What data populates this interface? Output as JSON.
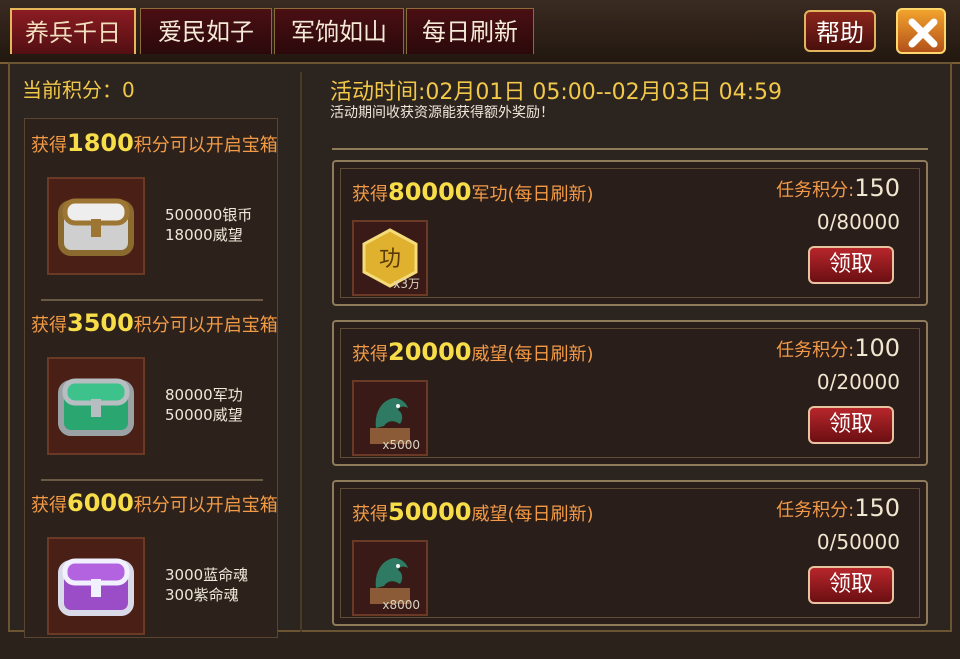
{
  "tabs": [
    {
      "label": "养兵千日"
    },
    {
      "label": "爱民如子"
    },
    {
      "label": "军饷如山"
    },
    {
      "label": "每日刷新"
    }
  ],
  "help_label": "帮助",
  "left": {
    "score_label": "当前积分：0",
    "chests": [
      {
        "title_prefix": "获得",
        "points": "1800",
        "title_suffix": "积分可以开启宝箱",
        "rewards": [
          "500000银币",
          "18000威望"
        ],
        "icon": "silver-chest-icon"
      },
      {
        "title_prefix": "获得",
        "points": "3500",
        "title_suffix": "积分可以开启宝箱",
        "rewards": [
          "80000军功",
          "50000威望"
        ],
        "icon": "green-chest-icon"
      },
      {
        "title_prefix": "获得",
        "points": "6000",
        "title_suffix": "积分可以开启宝箱",
        "rewards": [
          "3000蓝命魂",
          "300紫命魂"
        ],
        "icon": "purple-chest-icon"
      }
    ]
  },
  "event": {
    "time": "活动时间:02月01日 05:00--02月03日 04:59",
    "note": "活动期间收获资源能获得额外奖励！"
  },
  "tasks": [
    {
      "title_prefix": "获得",
      "amount": "80000",
      "title_suffix": "军功(每日刷新)",
      "points_label": "任务积分:",
      "points_value": "150",
      "progress": "0/80000",
      "claim_label": "领取",
      "icon": "merit-icon",
      "icon_text": "功",
      "qty": "x3万"
    },
    {
      "title_prefix": "获得",
      "amount": "20000",
      "title_suffix": "威望(每日刷新)",
      "points_label": "任务积分:",
      "points_value": "100",
      "progress": "0/20000",
      "claim_label": "领取",
      "icon": "dragon-statue-icon",
      "qty": "x5000"
    },
    {
      "title_prefix": "获得",
      "amount": "50000",
      "title_suffix": "威望(每日刷新)",
      "points_label": "任务积分:",
      "points_value": "150",
      "progress": "0/50000",
      "claim_label": "领取",
      "icon": "dragon-statue-icon",
      "qty": "x8000"
    }
  ],
  "colors": {
    "accent_gold": "#f7dd48",
    "accent_orange": "#f29a46",
    "tab_red": "#8b1c22"
  }
}
